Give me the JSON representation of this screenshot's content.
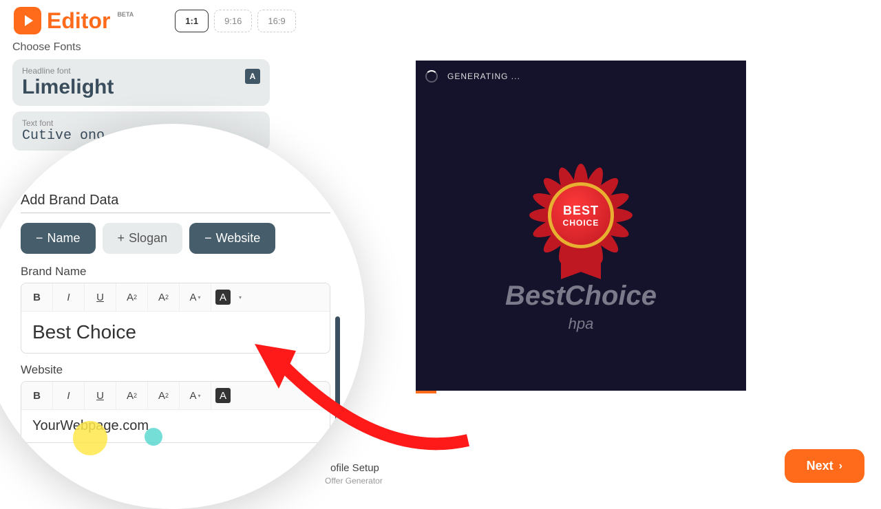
{
  "header": {
    "logo_text": "Editor",
    "beta": "BETA",
    "ratios": [
      {
        "label": "1:1",
        "active": true
      },
      {
        "label": "9:16",
        "active": false
      },
      {
        "label": "16:9",
        "active": false
      }
    ]
  },
  "fonts": {
    "section_title": "Choose Fonts",
    "headline_label": "Headline font",
    "headline_value": "Limelight",
    "text_label": "Text font",
    "text_value": "Cutive    ono",
    "color_badge": "A"
  },
  "brand": {
    "section_title": "Add Brand Data",
    "pills": {
      "name": "Name",
      "slogan": "Slogan",
      "website": "Website"
    },
    "name_label": "Brand Name",
    "name_value": "Best Choice",
    "website_label": "Website",
    "website_value": "YourWebpage.com"
  },
  "toolbar": {
    "bold": "B",
    "italic": "I",
    "underline": "U",
    "super": "A",
    "sub": "A",
    "color": "A",
    "invert": "A"
  },
  "preview": {
    "generating": "GENERATING ...",
    "badge_line1": "BEST",
    "badge_line2": "CHOICE",
    "brand_name": "BestChoice",
    "brand_sub": "hpa"
  },
  "footer": {
    "title": "ofile Setup",
    "sub": "Offer Generator",
    "next": "Next"
  }
}
